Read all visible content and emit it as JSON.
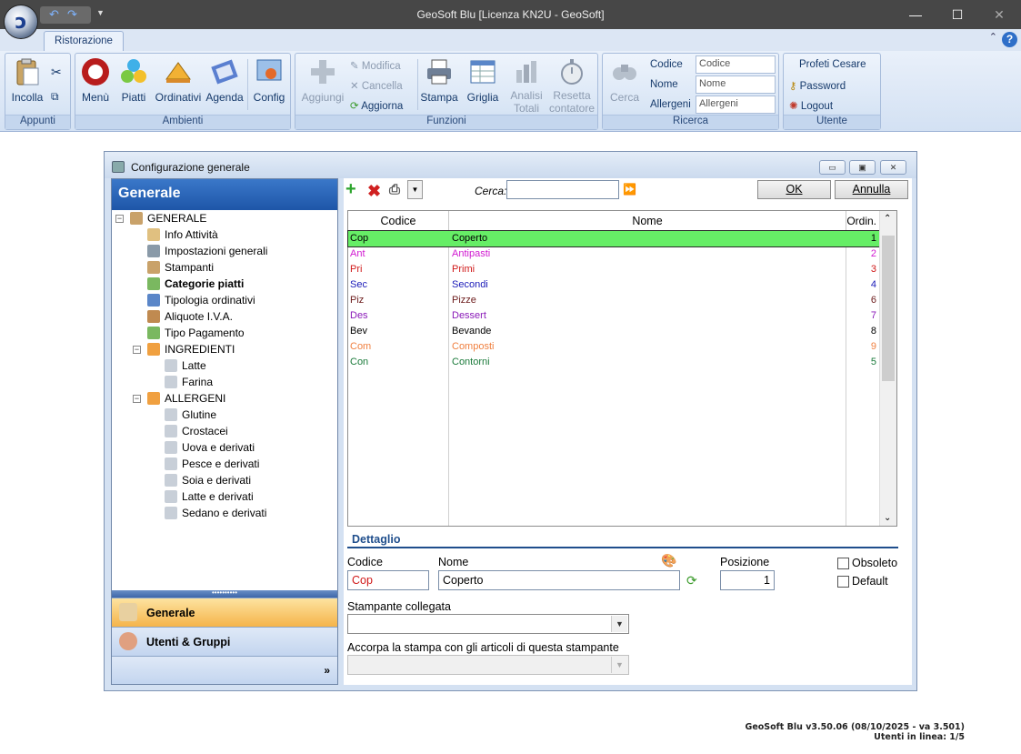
{
  "window": {
    "title": "GeoSoft Blu  [Licenza KN2U - GeoSoft]"
  },
  "ribbon": {
    "tab": "Ristorazione",
    "groups": {
      "appunti": {
        "label": "Appunti",
        "incolla": "Incolla"
      },
      "ambienti": {
        "label": "Ambienti",
        "menu": "Menù",
        "piatti": "Piatti",
        "ordinativi": "Ordinativi",
        "agenda": "Agenda",
        "config": "Config"
      },
      "funzioni": {
        "label": "Funzioni",
        "aggiungi": "Aggiungi",
        "modifica": "Modifica",
        "cancella": "Cancella",
        "aggiorna": "Aggiorna",
        "stampa": "Stampa",
        "griglia": "Griglia",
        "analisi1": "Analisi",
        "analisi2": "Totali",
        "resetta1": "Resetta",
        "resetta2": "contatore"
      },
      "ricerca": {
        "label": "Ricerca",
        "cerca": "Cerca",
        "codice_label": "Codice",
        "codice_ph": "Codice",
        "nome_label": "Nome",
        "nome_ph": "Nome",
        "allergeni_label": "Allergeni",
        "allergeni_ph": "Allergeni"
      },
      "utente": {
        "label": "Utente",
        "name": "Profeti Cesare",
        "password": "Password",
        "logout": "Logout"
      }
    }
  },
  "dialog": {
    "title": "Configurazione generale",
    "left_header": "Generale",
    "tree": [
      {
        "label": "GENERALE",
        "level": 0,
        "bold": false
      },
      {
        "label": "Info Attività",
        "level": 1,
        "bold": false
      },
      {
        "label": "Impostazioni generali",
        "level": 1,
        "bold": false
      },
      {
        "label": "Stampanti",
        "level": 1,
        "bold": false
      },
      {
        "label": "Categorie piatti",
        "level": 1,
        "bold": true
      },
      {
        "label": "Tipologia ordinativi",
        "level": 1,
        "bold": false
      },
      {
        "label": "Aliquote I.V.A.",
        "level": 1,
        "bold": false
      },
      {
        "label": "Tipo Pagamento",
        "level": 1,
        "bold": false
      },
      {
        "label": "INGREDIENTI",
        "level": 1,
        "bold": false
      },
      {
        "label": "Latte",
        "level": 2,
        "bold": false
      },
      {
        "label": "Farina",
        "level": 2,
        "bold": false
      },
      {
        "label": "ALLERGENI",
        "level": 1,
        "bold": false
      },
      {
        "label": "Glutine",
        "level": 2,
        "bold": false
      },
      {
        "label": "Crostacei",
        "level": 2,
        "bold": false
      },
      {
        "label": "Uova e derivati",
        "level": 2,
        "bold": false
      },
      {
        "label": "Pesce e derivati",
        "level": 2,
        "bold": false
      },
      {
        "label": "Soia e derivati",
        "level": 2,
        "bold": false
      },
      {
        "label": "Latte e derivati",
        "level": 2,
        "bold": false
      },
      {
        "label": "Sedano e derivati",
        "level": 2,
        "bold": false
      }
    ],
    "nav": {
      "generale": "Generale",
      "utenti": "Utenti & Gruppi"
    },
    "toolbar": {
      "cerca_label": "Cerca:",
      "ok": "OK",
      "annulla": "Annulla"
    },
    "grid": {
      "columns": [
        "Codice",
        "Nome",
        "Ordin."
      ],
      "rows": [
        {
          "codice": "Cop",
          "nome": "Coperto",
          "ordine": "1",
          "color": "#000000",
          "selected": true
        },
        {
          "codice": "Ant",
          "nome": "Antipasti",
          "ordine": "2",
          "color": "#d11ad1",
          "selected": false
        },
        {
          "codice": "Pri",
          "nome": "Primi",
          "ordine": "3",
          "color": "#d01818",
          "selected": false
        },
        {
          "codice": "Sec",
          "nome": "Secondi",
          "ordine": "4",
          "color": "#1a1ab8",
          "selected": false
        },
        {
          "codice": "Piz",
          "nome": "Pizze",
          "ordine": "6",
          "color": "#6b1a1a",
          "selected": false
        },
        {
          "codice": "Des",
          "nome": "Dessert",
          "ordine": "7",
          "color": "#8a1ab8",
          "selected": false
        },
        {
          "codice": "Bev",
          "nome": "Bevande",
          "ordine": "8",
          "color": "#000000",
          "selected": false
        },
        {
          "codice": "Com",
          "nome": "Composti",
          "ordine": "9",
          "color": "#f08040",
          "selected": false
        },
        {
          "codice": "Con",
          "nome": "Contorni",
          "ordine": "5",
          "color": "#1a7a3a",
          "selected": false
        }
      ],
      "selected_color": "#66ee66"
    },
    "detail": {
      "title": "Dettaglio",
      "codice_label": "Codice",
      "codice_value": "Cop",
      "nome_label": "Nome",
      "nome_value": "Coperto",
      "posizione_label": "Posizione",
      "posizione_value": "1",
      "obsoleto": "Obsoleto",
      "default": "Default",
      "stampante_label": "Stampante collegata",
      "accorpa_label": "Accorpa la stampa con gli articoli di questa stampante"
    }
  },
  "footer": {
    "version": "GeoSoft Blu  v3.50.06 (08/10/2025 - va 3.501)",
    "users": "Utenti in linea: 1/5"
  }
}
